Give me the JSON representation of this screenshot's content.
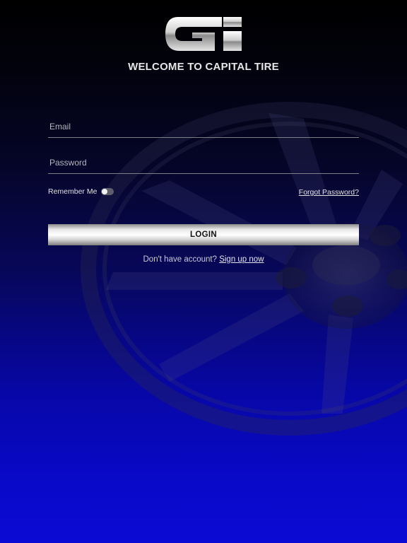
{
  "app": {
    "logo_name": "capital-tire-logo",
    "welcome_title": "WELCOME TO CAPITAL TIRE"
  },
  "form": {
    "email_placeholder": "Email",
    "email_value": "",
    "password_placeholder": "Password",
    "password_value": "",
    "remember_label": "Remember Me",
    "remember_on": false,
    "forgot_label": "Forgot Password?",
    "login_label": "LOGIN"
  },
  "signup": {
    "prompt": "Don't have account?",
    "link_label": "Sign up now"
  },
  "colors": {
    "background_top": "#000000",
    "background_bottom": "#0a0ad4",
    "text_light": "#e6e6e6",
    "field_underline": "#7e7e86",
    "button_silver": "#e8e8e8"
  }
}
